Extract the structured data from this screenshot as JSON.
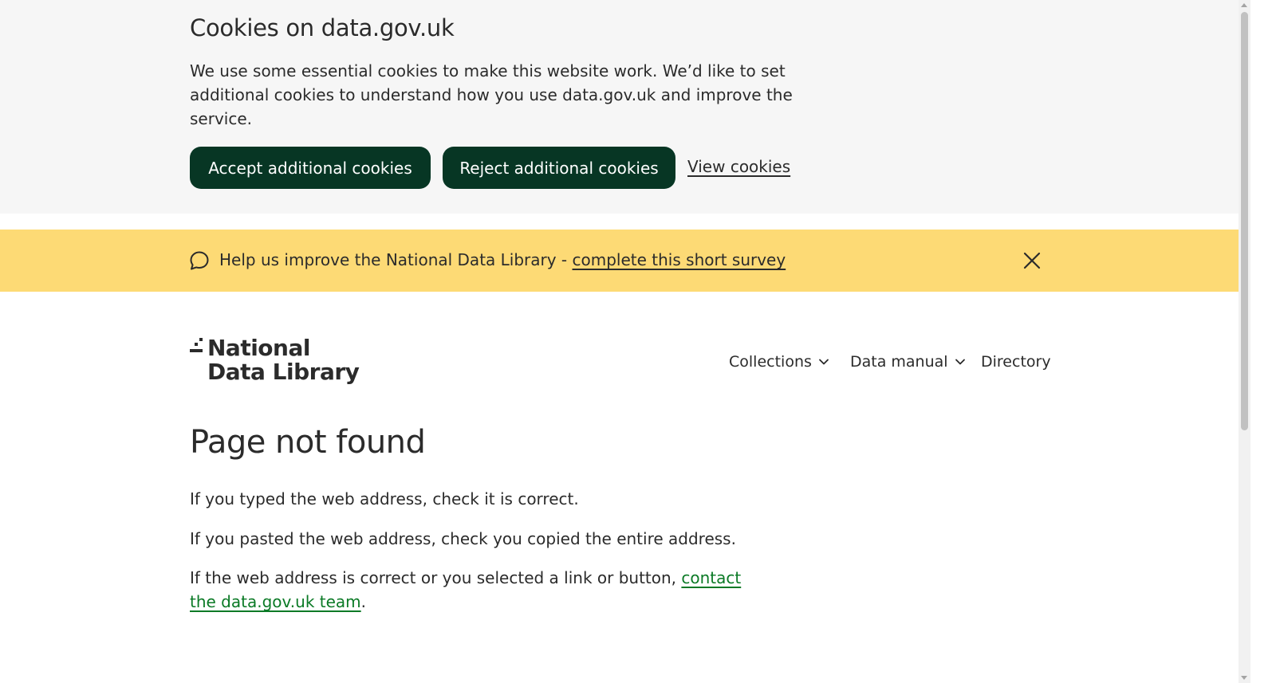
{
  "cookie_banner": {
    "title": "Cookies on data.gov.uk",
    "text": "We use some essential cookies to make this website work. We’d like to set additional cookies to understand how you use data.gov.uk and improve the service.",
    "accept_label": "Accept additional cookies",
    "reject_label": "Reject additional cookies",
    "view_label": "View cookies"
  },
  "survey_banner": {
    "text": "Help us improve the National Data Library - ",
    "link_label": "complete this short survey",
    "icon": "speech-bubble-icon",
    "close_icon": "close-icon"
  },
  "header": {
    "logo_line1": "National",
    "logo_line2": "Data Library",
    "nav": [
      {
        "label": "Collections",
        "has_dropdown": true
      },
      {
        "label": "Data manual",
        "has_dropdown": true
      },
      {
        "label": "Directory",
        "has_dropdown": false
      }
    ]
  },
  "main": {
    "title": "Page not found",
    "p1": "If you typed the web address, check it is correct.",
    "p2": "If you pasted the web address, check you copied the entire address.",
    "p3_prefix": "If the web address is correct or you selected a link or button, ",
    "p3_link": "contact the data.gov.uk team",
    "p3_suffix": "."
  },
  "colors": {
    "button_bg": "#073624",
    "survey_bg": "#fdda75",
    "cookie_bg": "#f6f6f6",
    "link_green": "#0b7a26",
    "text": "#2b2b2b"
  }
}
